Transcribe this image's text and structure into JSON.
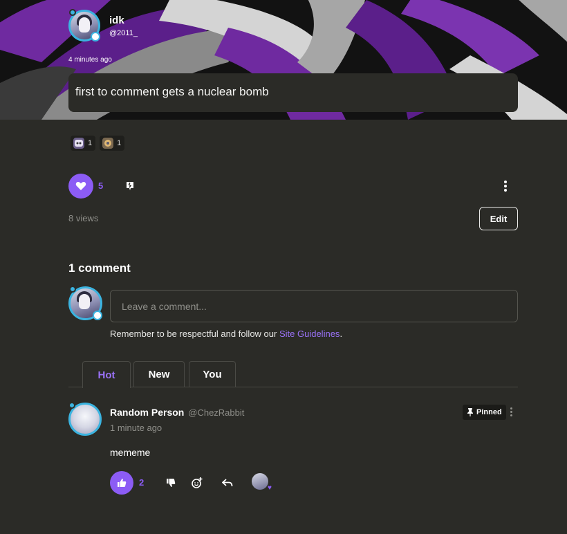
{
  "post": {
    "author_name": "idk",
    "author_handle": "@2011_",
    "timestamp": "4 minutes ago",
    "text": "first to comment gets a nuclear bomb",
    "reactions": [
      {
        "icon": "sticker-emoji-icon",
        "count": "1"
      },
      {
        "icon": "sticker-gear-icon",
        "count": "1"
      }
    ],
    "likes": "5",
    "views": "8 views",
    "edit_label": "Edit"
  },
  "comments": {
    "heading": "1 comment",
    "input_placeholder": "Leave a comment...",
    "guidelines_prefix": "Remember to be respectful and follow our",
    "guidelines_link": "Site Guidelines",
    "guidelines_suffix": ".",
    "tabs": [
      "Hot",
      "New",
      "You"
    ],
    "items": [
      {
        "name": "Random Person",
        "handle": "@ChezRabbit",
        "time": "1 minute ago",
        "pinned_label": "Pinned",
        "body": "mememe",
        "likes": "2"
      }
    ]
  },
  "colors": {
    "accent": "#8c5cf5",
    "background": "#2b2b27",
    "avatar_ring": "#3bb4e0"
  }
}
